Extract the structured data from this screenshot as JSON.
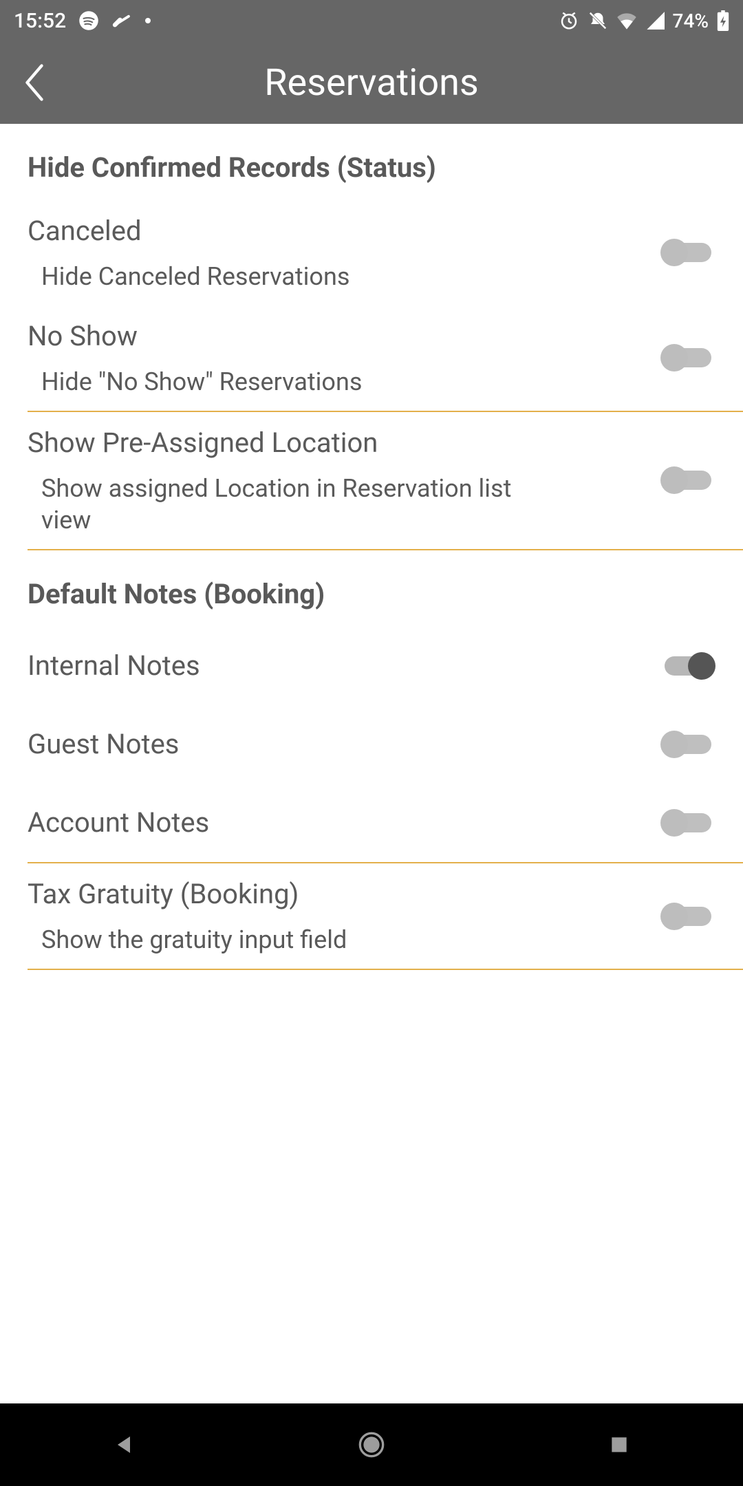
{
  "status": {
    "time": "15:52",
    "battery_text": "74%"
  },
  "app_bar": {
    "title": "Reservations"
  },
  "sections": {
    "hide_confirmed": {
      "header": "Hide Confirmed Records (Status)",
      "canceled": {
        "title": "Canceled",
        "sub": "Hide Canceled Reservations",
        "on": false
      },
      "noshow": {
        "title": "No Show",
        "sub": "Hide \"No Show\" Reservations",
        "on": false
      }
    },
    "pre_assigned": {
      "title": "Show Pre-Assigned Location",
      "sub": "Show assigned Location in Reservation list view",
      "on": false
    },
    "default_notes": {
      "header": "Default Notes (Booking)",
      "internal": {
        "title": "Internal Notes",
        "on": true
      },
      "guest": {
        "title": "Guest Notes",
        "on": false
      },
      "account": {
        "title": "Account Notes",
        "on": false
      }
    },
    "tax_gratuity": {
      "title": "Tax Gratuity (Booking)",
      "sub": "Show the gratuity input field",
      "on": false
    }
  }
}
